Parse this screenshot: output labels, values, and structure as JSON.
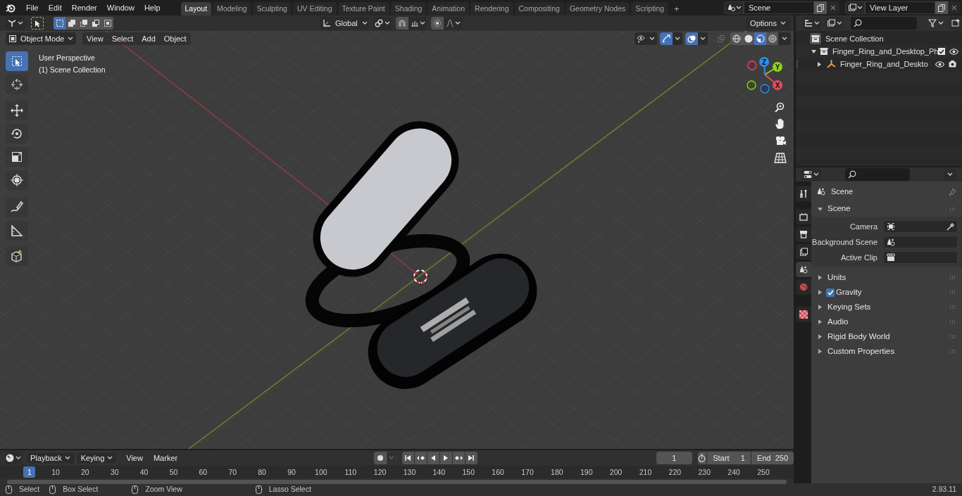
{
  "menu": [
    "File",
    "Edit",
    "Render",
    "Window",
    "Help"
  ],
  "workspaces": [
    {
      "label": "Layout",
      "selected": true
    },
    {
      "label": "Modeling",
      "selected": false
    },
    {
      "label": "Sculpting",
      "selected": false
    },
    {
      "label": "UV Editing",
      "selected": false
    },
    {
      "label": "Texture Paint",
      "selected": false
    },
    {
      "label": "Shading",
      "selected": false
    },
    {
      "label": "Animation",
      "selected": false
    },
    {
      "label": "Rendering",
      "selected": false
    },
    {
      "label": "Compositing",
      "selected": false
    },
    {
      "label": "Geometry Nodes",
      "selected": false
    },
    {
      "label": "Scripting",
      "selected": false
    }
  ],
  "add_workspace": "+",
  "scene_selector": {
    "value": "Scene"
  },
  "view_layer_selector": {
    "value": "View Layer"
  },
  "viewport": {
    "select_modes": [
      {
        "selected": true
      },
      {
        "selected": false
      },
      {
        "selected": false
      },
      {
        "selected": false
      },
      {
        "selected": false
      }
    ],
    "orientation": "Global",
    "options": "Options",
    "mode": "Object Mode",
    "menus": [
      "View",
      "Select",
      "Add",
      "Object"
    ],
    "overlay_lines": [
      "User Perspective",
      "(1) Scene Collection"
    ],
    "tools": [
      {
        "selected": true
      },
      {
        "selected": false
      },
      {
        "selected": false
      },
      {
        "selected": false
      },
      {
        "selected": false
      },
      {
        "selected": false
      },
      {
        "selected": false
      },
      {
        "selected": false
      },
      {
        "selected": false
      }
    ],
    "shading": [
      {
        "selected": false
      },
      {
        "selected": false
      },
      {
        "selected": true
      },
      {
        "selected": false
      }
    ],
    "gizmo_axes": [
      "X",
      "Y",
      "Z"
    ]
  },
  "outliner": {
    "tree": [
      {
        "label": "Scene Collection",
        "children": [
          {
            "label": "Finger_Ring_and_Desktop_Ph",
            "expanded": true,
            "checked": true,
            "children": [
              {
                "label": "Finger_Ring_and_Deskto",
                "expanded": false
              }
            ]
          }
        ]
      }
    ]
  },
  "properties": {
    "tabs": [
      {
        "selected": false
      },
      {
        "selected": false
      },
      {
        "selected": false
      },
      {
        "selected": false
      },
      {
        "selected": true
      },
      {
        "selected": false
      },
      {
        "selected": false
      }
    ],
    "title": "Scene",
    "panel": {
      "label": "Scene",
      "expanded": true,
      "fields": [
        {
          "label": "Camera"
        },
        {
          "label": "Background Scene"
        },
        {
          "label": "Active Clip"
        }
      ]
    },
    "subpanels": [
      {
        "label": "Units",
        "kind": "plain",
        "expanded": false
      },
      {
        "label": "Gravity",
        "kind": "checkbox",
        "checked": true,
        "expanded": false
      },
      {
        "label": "Keying Sets",
        "kind": "plain",
        "expanded": false
      },
      {
        "label": "Audio",
        "kind": "plain",
        "expanded": false
      },
      {
        "label": "Rigid Body World",
        "kind": "plain",
        "expanded": false
      },
      {
        "label": "Custom Properties",
        "kind": "plain",
        "expanded": false
      }
    ]
  },
  "timeline": {
    "menus": [
      "Playback",
      "Keying",
      "View",
      "Marker"
    ],
    "current_frame": "1",
    "start_label": "Start",
    "start": "1",
    "end_label": "End",
    "end": "250",
    "playhead": "1",
    "ticks": [
      "10",
      "20",
      "30",
      "40",
      "50",
      "60",
      "70",
      "80",
      "90",
      "100",
      "110",
      "120",
      "130",
      "140",
      "150",
      "160",
      "170",
      "180",
      "190",
      "200",
      "210",
      "220",
      "230",
      "240",
      "250"
    ]
  },
  "status_bar": {
    "hints": [
      "Select",
      "Box Select",
      "Zoom View",
      "Lasso Select"
    ],
    "version": "2.93.11"
  }
}
